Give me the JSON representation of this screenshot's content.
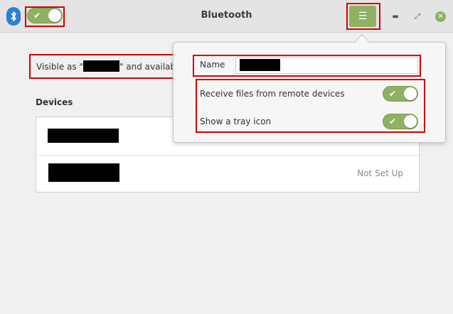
{
  "window": {
    "title": "Bluetooth",
    "menu_icon": "hamburger-menu-icon",
    "minimize_icon": "minimize-icon",
    "maximize_icon": "maximize-icon",
    "close_icon": "close-icon",
    "bluetooth_icon": "bluetooth-icon",
    "bluetooth_enabled": true,
    "accent_color": "#8fb162",
    "highlight_color": "#d40000"
  },
  "main": {
    "visible_prefix": "Visible as \"",
    "visible_suffix": "\" and availab",
    "devices_label": "Devices",
    "devices": [
      {
        "status": ""
      },
      {
        "status": "Not Set Up"
      }
    ]
  },
  "popover": {
    "name_label": "Name",
    "options": [
      {
        "label": "Receive files from remote devices",
        "enabled": true
      },
      {
        "label": "Show a tray icon",
        "enabled": true
      }
    ]
  }
}
